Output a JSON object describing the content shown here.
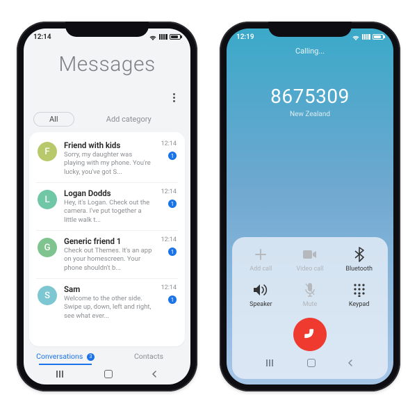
{
  "left": {
    "statusbar": {
      "time": "12:14"
    },
    "title": "Messages",
    "filter_pill": "All",
    "add_category": "Add category",
    "conversations": [
      {
        "initial": "F",
        "color": "#b7c96a",
        "name": "Friend with kids",
        "preview": "Sorry, my daughter was playing with my phone. You're lucky, you've got S...",
        "time": "12:14",
        "unread": "1"
      },
      {
        "initial": "L",
        "color": "#6fc7a6",
        "name": "Logan Dodds",
        "preview": "Hey, it's Logan. Check out the camera. I've put together a little walk t...",
        "time": "12:14",
        "unread": "1"
      },
      {
        "initial": "G",
        "color": "#7fc48e",
        "name": "Generic friend 1",
        "preview": "Check out Themes. It's an app on your homescreen. Your phone shouldn't b...",
        "time": "12:14",
        "unread": "1"
      },
      {
        "initial": "S",
        "color": "#7cc7d2",
        "name": "Sam",
        "preview": "Welcome to the other side. Swipe up, down, left and right, see what ever...",
        "time": "12:14",
        "unread": "1"
      }
    ],
    "bottom_tabs": {
      "conversations": "Conversations",
      "conversations_badge": "3",
      "contacts": "Contacts"
    }
  },
  "right": {
    "statusbar": {
      "time": "12:19"
    },
    "status": "Calling...",
    "number": "8675309",
    "region": "New Zealand",
    "buttons": {
      "add_call": "Add call",
      "video_call": "Video call",
      "bluetooth": "Bluetooth",
      "speaker": "Speaker",
      "mute": "Mute",
      "keypad": "Keypad"
    }
  }
}
